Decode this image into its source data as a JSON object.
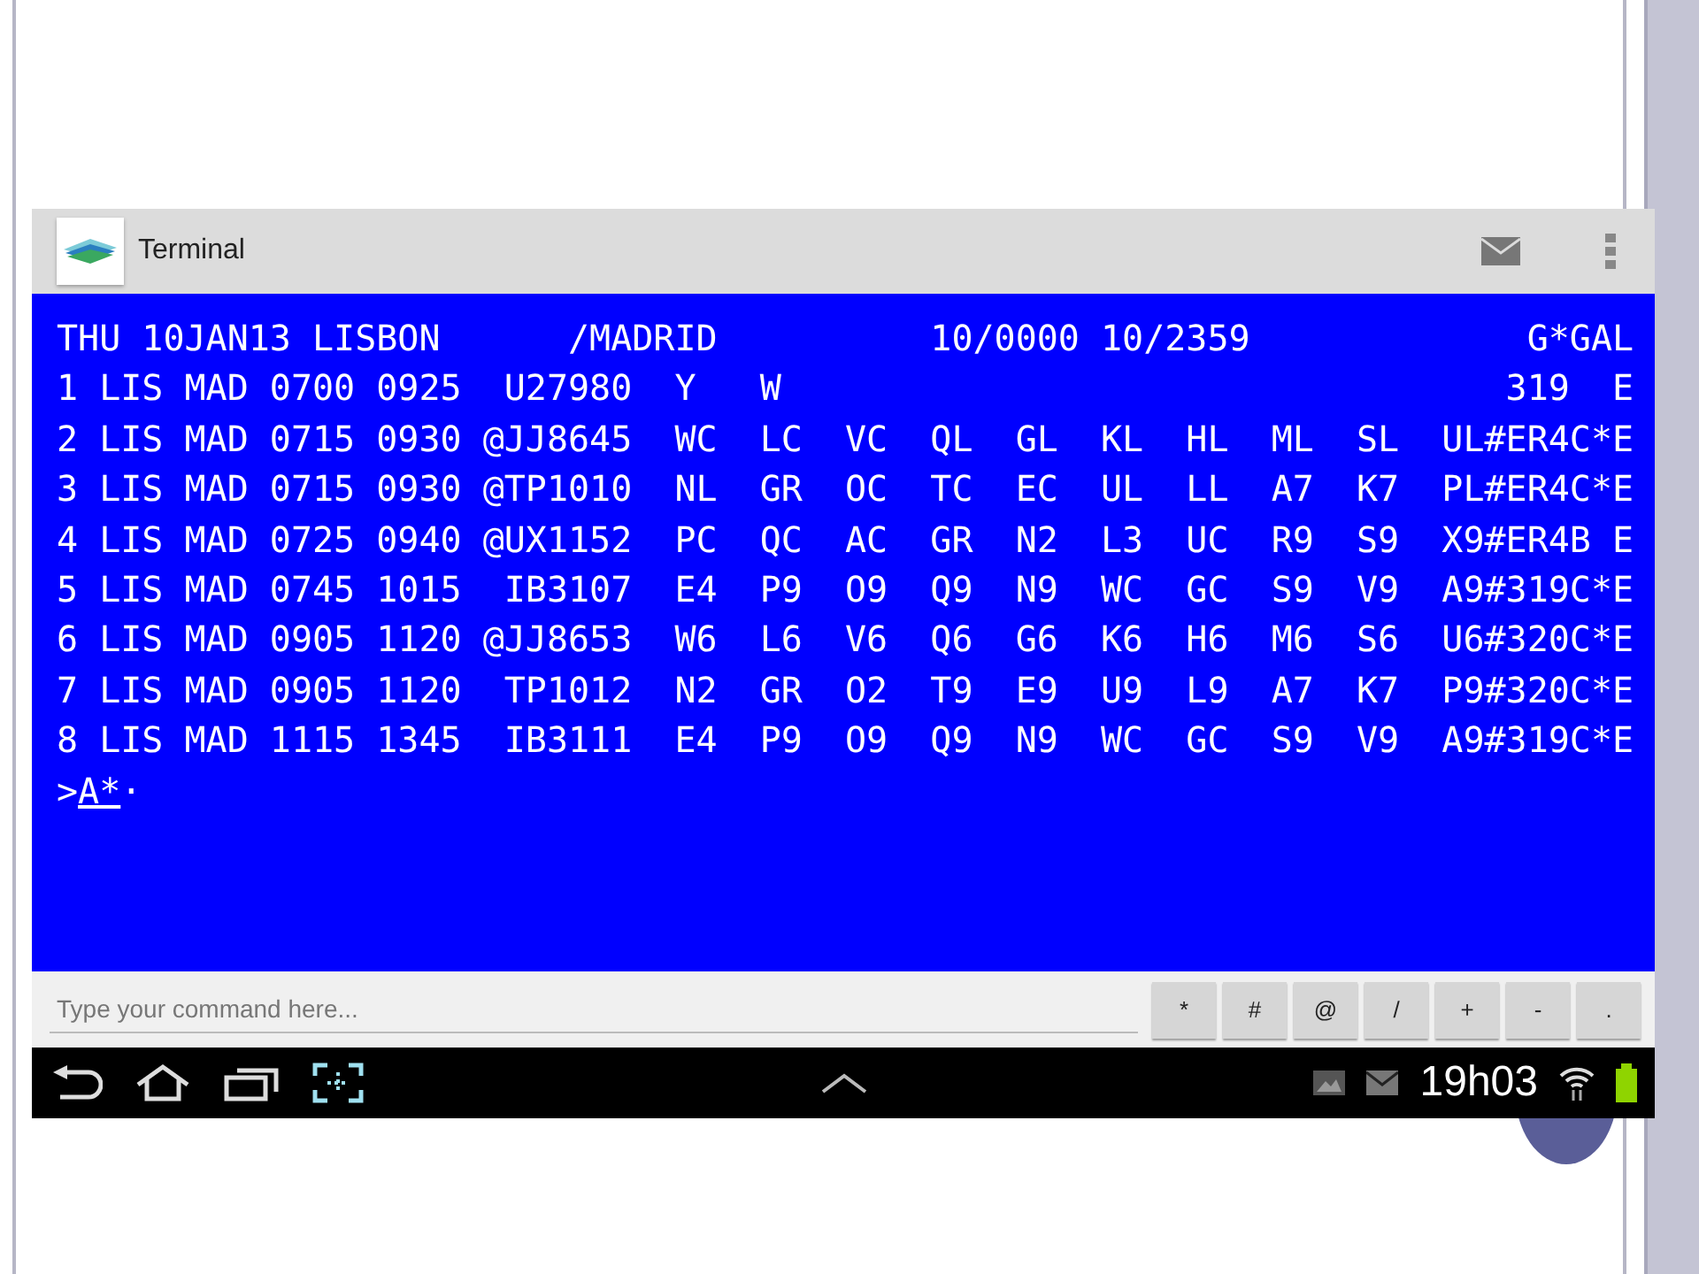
{
  "app_bar": {
    "title": "Terminal"
  },
  "terminal": {
    "lines": [
      "THU 10JAN13 LISBON      /MADRID          10/0000 10/2359             G*GAL",
      "1 LIS MAD 0700 0925  U27980  Y   W                                  319  E",
      "2 LIS MAD 0715 0930 @JJ8645  WC  LC  VC  QL  GL  KL  HL  ML  SL  UL#ER4C*E",
      "3 LIS MAD 0715 0930 @TP1010  NL  GR  OC  TC  EC  UL  LL  A7  K7  PL#ER4C*E",
      "4 LIS MAD 0725 0940 @UX1152  PC  QC  AC  GR  N2  L3  UC  R9  S9  X9#ER4B E",
      "5 LIS MAD 0745 1015  IB3107  E4  P9  O9  Q9  N9  WC  GC  S9  V9  A9#319C*E",
      "6 LIS MAD 0905 1120 @JJ8653  W6  L6  V6  Q6  G6  K6  H6  M6  S6  U6#320C*E",
      "7 LIS MAD 0905 1120  TP1012  N2  GR  O2  T9  E9  U9  L9  A7  K7  P9#320C*E",
      "8 LIS MAD 1115 1345  IB3111  E4  P9  O9  Q9  N9  WC  GC  S9  V9  A9#319C*E"
    ],
    "prompt": ">",
    "input": "A*",
    "cursor": "·"
  },
  "command_field": {
    "placeholder": "Type your command here..."
  },
  "keys": [
    "*",
    "#",
    "@",
    "/",
    "+",
    "-",
    "."
  ],
  "status_bar": {
    "time": "19h03"
  }
}
